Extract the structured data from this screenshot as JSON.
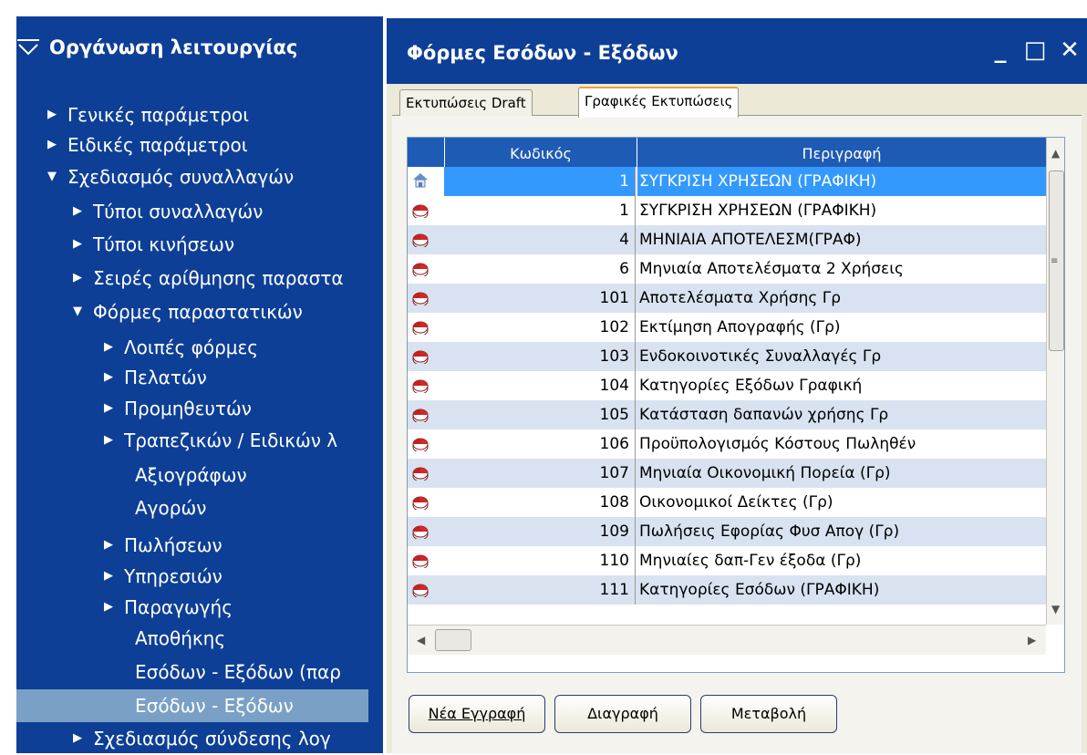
{
  "nav": {
    "header": "Οργάνωση λειτουργίας",
    "items": [
      {
        "label": "Γενικές παράμετροι",
        "arrow": "▶"
      },
      {
        "label": "Ειδικές παράμετροι",
        "arrow": "▶"
      },
      {
        "label": "Σχεδιασμός συναλλαγών",
        "arrow": "▼"
      },
      {
        "label": "Τύποι συναλλαγών",
        "arrow": "▶"
      },
      {
        "label": "Τύποι κινήσεων",
        "arrow": "▶"
      },
      {
        "label": "Σειρές αρίθμησης παραστα",
        "arrow": "▶"
      },
      {
        "label": "Φόρμες παραστατικών",
        "arrow": "▼"
      },
      {
        "label": "Λοιπές φόρμες",
        "arrow": "▶"
      },
      {
        "label": "Πελατών",
        "arrow": "▶"
      },
      {
        "label": "Προμηθευτών",
        "arrow": "▶"
      },
      {
        "label": "Τραπεζικών / Ειδικών λ",
        "arrow": "▶"
      },
      {
        "label": "Αξιογράφων",
        "arrow": ""
      },
      {
        "label": "Αγορών",
        "arrow": ""
      },
      {
        "label": "Πωλήσεων",
        "arrow": "▶"
      },
      {
        "label": "Υπηρεσιών",
        "arrow": "▶"
      },
      {
        "label": "Παραγωγής",
        "arrow": "▶"
      },
      {
        "label": "Αποθήκης",
        "arrow": ""
      },
      {
        "label": "Εσόδων - Εξόδων (παρ",
        "arrow": ""
      },
      {
        "label": "Εσόδων - Εξόδων",
        "arrow": ""
      },
      {
        "label": "Σχεδιασμός σύνδεσης λογ",
        "arrow": "▶"
      }
    ]
  },
  "window": {
    "title": "Φόρμες Εσόδων - Εξόδων",
    "controls": {
      "minimize": "_",
      "maximize": "□",
      "close": "✕"
    },
    "tabs": [
      {
        "label": "Εκτυπώσεις Draft"
      },
      {
        "label": "Γραφικές Εκτυπώσεις"
      }
    ]
  },
  "grid": {
    "columns": [
      "Κωδικός",
      "Περιγραφή"
    ],
    "rows": [
      {
        "code": "1",
        "desc": "ΣΥΓΚΡΙΣΗ ΧΡΗΣΕΩΝ (ΓΡΑΦΙΚΗ)",
        "icon": "home-icon"
      },
      {
        "code": "1",
        "desc": "ΣΥΓΚΡΙΣΗ ΧΡΗΣΕΩΝ (ΓΡΑΦΙΚΗ)",
        "icon": "chart-icon"
      },
      {
        "code": "4",
        "desc": "ΜΗΝΙΑΙΑ ΑΠΟΤΕΛΕΣΜ(ΓΡΑΦ)",
        "icon": "chart-icon"
      },
      {
        "code": "6",
        "desc": "Μηνιαία Αποτελέσματα 2 Χρήσεις",
        "icon": "chart-icon"
      },
      {
        "code": "101",
        "desc": "Αποτελέσματα Χρήσης Γρ",
        "icon": "chart-icon"
      },
      {
        "code": "102",
        "desc": "Εκτίμηση Απογραφής (Γρ)",
        "icon": "chart-icon"
      },
      {
        "code": "103",
        "desc": "Ενδοκοινοτικές  Συναλλαγές Γρ",
        "icon": "chart-icon"
      },
      {
        "code": "104",
        "desc": "Κατηγορίες Εξόδων Γραφική",
        "icon": "chart-icon"
      },
      {
        "code": "105",
        "desc": "Κατάσταση δαπανών χρήσης Γρ",
        "icon": "chart-icon"
      },
      {
        "code": "106",
        "desc": "Προϋπολογισμός Κόστους Πωληθέν",
        "icon": "chart-icon"
      },
      {
        "code": "107",
        "desc": "Μηνιαία Οικονομική Πορεία (Γρ)",
        "icon": "chart-icon"
      },
      {
        "code": "108",
        "desc": "Οικονομικοί Δείκτες (Γρ)",
        "icon": "chart-icon"
      },
      {
        "code": "109",
        "desc": "Πωλήσεις Εφορίας Φυσ Απογ (Γρ)",
        "icon": "chart-icon"
      },
      {
        "code": "110",
        "desc": "Μηνιαίες δαπ-Γεν έξοδα (Γρ)",
        "icon": "chart-icon"
      },
      {
        "code": "111",
        "desc": "Κατηγορίες Εσόδων (ΓΡΑΦΙΚΗ)",
        "icon": "chart-icon"
      }
    ]
  },
  "buttons": {
    "new": "Νέα Εγγραφή",
    "delete": "Διαγραφή",
    "modify": "Μεταβολή"
  },
  "colors": {
    "nav_bg": "#0e3f96",
    "header_bg": "#1e5bb4",
    "selected_row": "#3399ff",
    "alt_row": "#d9e2f0",
    "nav_selected": "#7aa0c6"
  }
}
